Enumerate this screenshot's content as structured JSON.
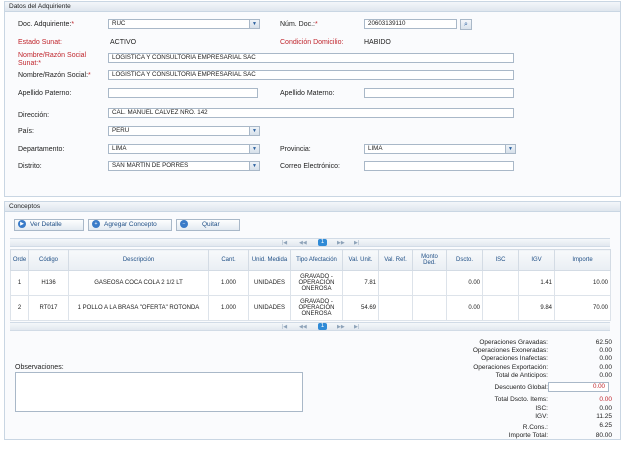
{
  "adquiriente": {
    "title": "Datos del Adquiriente",
    "doc_label": "Doc. Adquiriente:",
    "doc_value": "RUC",
    "num_label": "Núm. Doc.:",
    "num_value": "20603139110",
    "estado_label": "Estado Sunat:",
    "estado_value": "ACTIVO",
    "condicion_label": "Condición Domicilio:",
    "condicion_value": "HABIDO",
    "nombre_sunat_label_1": "Nombre/Razón Social",
    "nombre_sunat_label_2": "Sunat:",
    "nombre_sunat_value": "LOGISTICA Y CONSULTORIA EMPRESARIAL SAC",
    "nombre_label": "Nombre/Razón Social:",
    "nombre_value": "LOGISTICA Y CONSULTORIA EMPRESARIAL SAC",
    "apellido_paterno_label": "Apellido Paterno:",
    "apellido_paterno_value": "",
    "apellido_materno_label": "Apellido Materno:",
    "apellido_materno_value": "",
    "direccion_label": "Dirección:",
    "direccion_value": "CAL. MANUEL CALVEZ NRO. 142",
    "pais_label": "País:",
    "pais_value": "PERÚ",
    "departamento_label": "Departamento:",
    "departamento_value": "LIMA",
    "provincia_label": "Provincia:",
    "provincia_value": "LIMA",
    "distrito_label": "Distrito:",
    "distrito_value": "SAN MARTÍN DE PORRES",
    "correo_label": "Correo Electrónico:",
    "correo_value": ""
  },
  "conceptos": {
    "title": "Conceptos",
    "buttons": {
      "ver": "Ver Detalle",
      "agregar": "Agregar Concepto",
      "quitar": "Quitar"
    },
    "page_current": "1",
    "columns": [
      "Orde",
      "Código",
      "Descripción",
      "Cant.",
      "Unid. Medida",
      "Tipo Afectación",
      "Val. Unit.",
      "Val. Ref.",
      "Monto Ded.",
      "Dscto.",
      "ISC",
      "IGV",
      "Importe"
    ],
    "rows": [
      {
        "orden": "1",
        "codigo": "H136",
        "descripcion": "GASEOSA COCA COLA 2 1/2 LT",
        "cant": "1.000",
        "unidad": "UNIDADES",
        "tipo": "GRAVADO - OPERACIÓN ONEROSA",
        "val_unit": "7.81",
        "val_ref": "",
        "monto_ded": "",
        "dscto": "0.00",
        "isc": "",
        "igv": "1.41",
        "importe": "10.00"
      },
      {
        "orden": "2",
        "codigo": "RT017",
        "descripcion": "1 POLLO A LA BRASA \"OFERTA\" ROTONDA",
        "cant": "1.000",
        "unidad": "UNIDADES",
        "tipo": "GRAVADO - OPERACIÓN ONEROSA",
        "val_unit": "54.69",
        "val_ref": "",
        "monto_ded": "",
        "dscto": "0.00",
        "isc": "",
        "igv": "9.84",
        "importe": "70.00"
      }
    ]
  },
  "observaciones": {
    "label": "Observaciones:",
    "value": ""
  },
  "totales": {
    "gravadas_label": "Operaciones Gravadas:",
    "gravadas": "62.50",
    "exoneradas_label": "Operaciones Exoneradas:",
    "exoneradas": "0.00",
    "inafectas_label": "Operaciones Inafectas:",
    "inafectas": "0.00",
    "exportacion_label": "Operaciones Exportación:",
    "exportacion": "0.00",
    "anticipos_label": "Total de Anticipos:",
    "anticipos": "0.00",
    "descuento_label": "Descuento Global:",
    "descuento": "0.00",
    "total_dscto_label": "Total Dscto. Items:",
    "total_dscto": "0.00",
    "isc_label": "ISC:",
    "isc": "0.00",
    "igv_label": "IGV:",
    "igv": "11.25",
    "rcons_label": "R.Cons.:",
    "rcons": "6.25",
    "importe_label": "Importe Total:",
    "importe": "80.00"
  },
  "colors": {
    "accent": "#2a5f9e",
    "required": "#c0262d",
    "border": "#a9b8c8"
  },
  "icons": {
    "search": "search-icon",
    "dropdown": "chevron-down-icon",
    "play": "play-icon",
    "add": "plus-icon",
    "remove": "minus-icon",
    "first": "first-page-icon",
    "prev": "prev-page-icon",
    "next": "next-page-icon",
    "last": "last-page-icon"
  }
}
